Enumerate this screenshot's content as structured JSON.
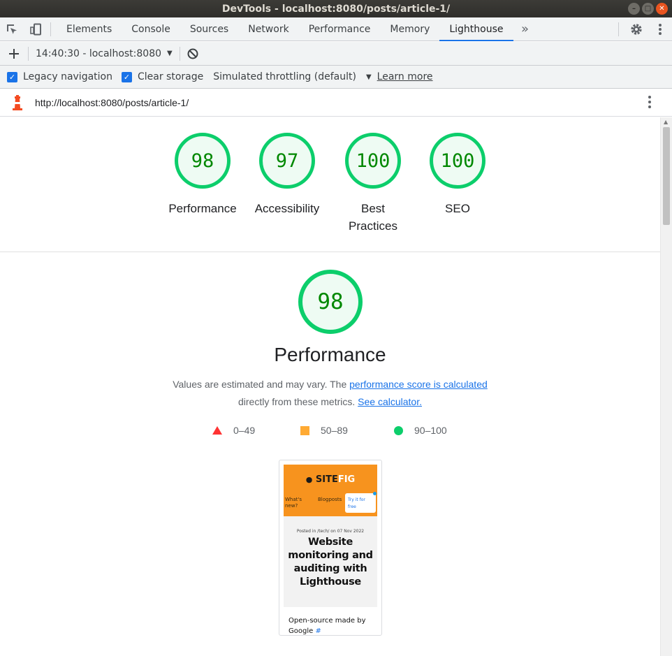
{
  "window": {
    "title": "DevTools - localhost:8080/posts/article-1/"
  },
  "tabs": [
    {
      "label": "Elements"
    },
    {
      "label": "Console"
    },
    {
      "label": "Sources"
    },
    {
      "label": "Network"
    },
    {
      "label": "Performance"
    },
    {
      "label": "Memory"
    },
    {
      "label": "Lighthouse"
    }
  ],
  "toolbar": {
    "report_selector": "14:40:30 - localhost:8080"
  },
  "options": {
    "legacy_navigation": "Legacy navigation",
    "clear_storage": "Clear storage",
    "throttling": "Simulated throttling (default)",
    "learn_more": "Learn more"
  },
  "url": "http://localhost:8080/posts/article-1/",
  "scores": [
    {
      "score": "98",
      "label": "Performance"
    },
    {
      "score": "97",
      "label": "Accessibility"
    },
    {
      "score": "100",
      "label": "Best Practices"
    },
    {
      "score": "100",
      "label": "SEO"
    }
  ],
  "performance": {
    "score": "98",
    "title": "Performance",
    "desc_prefix": "Values are estimated and may vary. The ",
    "desc_link1": "performance score is calculated",
    "desc_middle": "directly from these metrics. ",
    "desc_link2": "See calculator."
  },
  "legend": {
    "fail": "0–49",
    "average": "50–89",
    "pass": "90–100"
  },
  "screenshot": {
    "logo_a": "SITE",
    "logo_b": "FIG",
    "nav1": "What's new?",
    "nav2": "Blogposts",
    "try": "Try it for free",
    "posted": "Posted in /tech/ on 07 Nov 2022",
    "headline": "Website monitoring and auditing with Lighthouse",
    "foot": "Open-source made by Google",
    "foot_hash": "#"
  },
  "colors": {
    "pass": "#0cce6b",
    "average": "#ffaa33",
    "fail": "#ff3333",
    "accent": "#1a73e8"
  }
}
